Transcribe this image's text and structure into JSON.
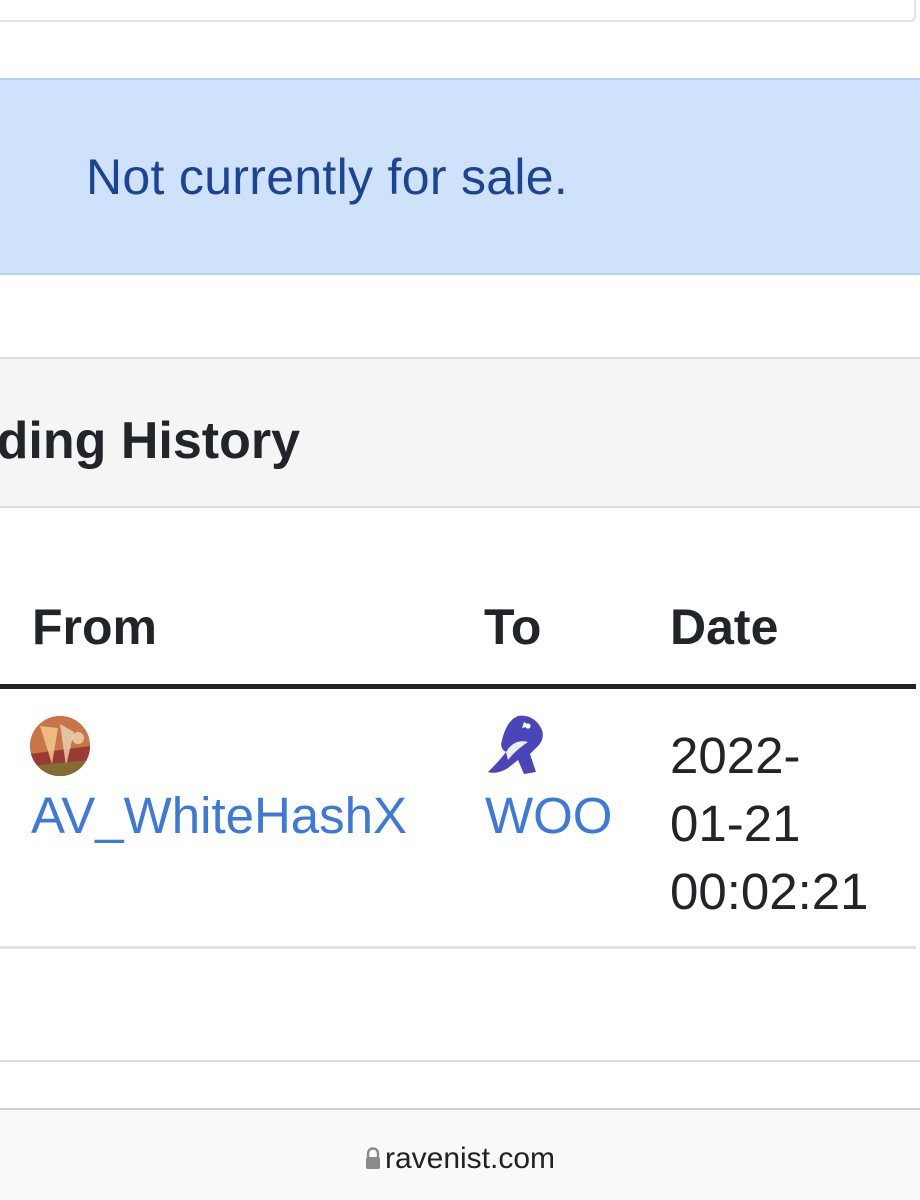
{
  "sale_status": {
    "message": "Not currently for sale."
  },
  "trading_history": {
    "title": "ding History",
    "columns": {
      "from": "From",
      "to": "To",
      "date": "Date"
    },
    "rows": [
      {
        "from": "AV_WhiteHashX",
        "to": "WOO",
        "date_line1": "2022-",
        "date_line2": "01-21",
        "date_line3": "00:02:21"
      }
    ]
  },
  "browser": {
    "url": "ravenist.com",
    "lock_icon": "lock-icon"
  },
  "colors": {
    "alert_bg": "#cfe2fb",
    "alert_text": "#1d4494",
    "link": "#3d79d8",
    "raven_icon": "#4a45b8"
  }
}
